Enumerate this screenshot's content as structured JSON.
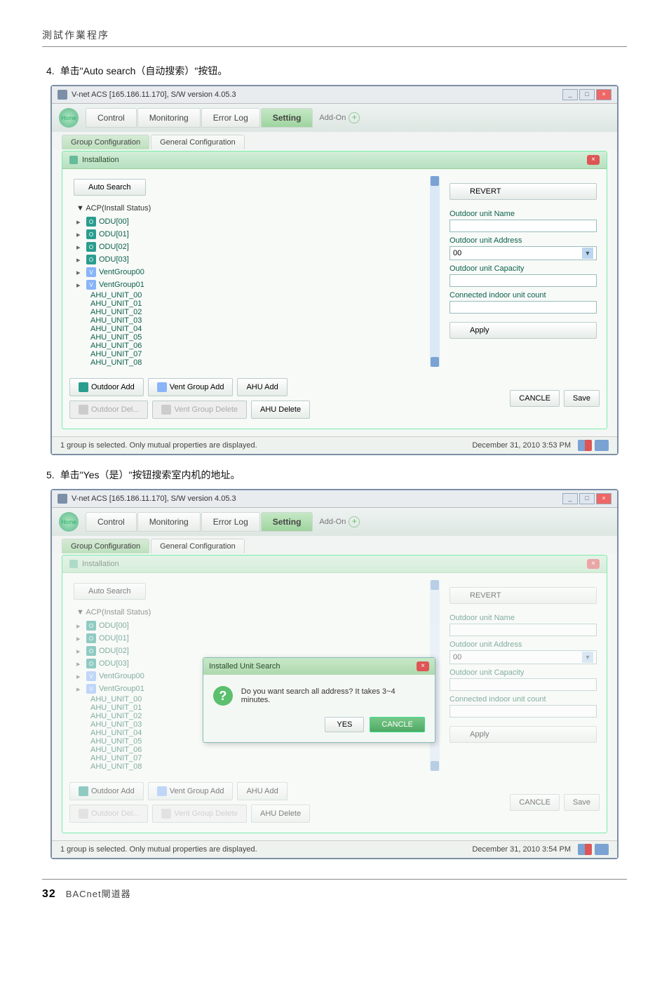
{
  "header": {
    "breadcrumb": "測試作業程序"
  },
  "steps": {
    "s4": {
      "num": "4.",
      "text": "单击\"Auto search（自动搜索）\"按钮。"
    },
    "s5": {
      "num": "5.",
      "text": "单击\"Yes（是）\"按钮搜索室内机的地址。"
    }
  },
  "window": {
    "title": "V-net ACS [165.186.11.170],   S/W version 4.05.3",
    "nav": {
      "home": "Home",
      "control": "Control",
      "monitoring": "Monitoring",
      "errorlog": "Error Log",
      "setting": "Setting",
      "addon": "Add-On"
    },
    "subtabs": {
      "group": "Group Configuration",
      "general": "General Configuration"
    },
    "innerTitle": "Installation",
    "autoSearch": "Auto Search",
    "revert": "REVERT",
    "tree": {
      "root": "▼ ACP(Install Status)",
      "odu": [
        "ODU[00]",
        "ODU[01]",
        "ODU[02]",
        "ODU[03]"
      ],
      "vent": [
        "VentGroup00",
        "VentGroup01"
      ],
      "ahu": [
        "AHU_UNIT_00",
        "AHU_UNIT_01",
        "AHU_UNIT_02",
        "AHU_UNIT_03",
        "AHU_UNIT_04",
        "AHU_UNIT_05",
        "AHU_UNIT_06",
        "AHU_UNIT_07",
        "AHU_UNIT_08"
      ]
    },
    "fields": {
      "name": "Outdoor unit Name",
      "address": "Outdoor unit Address",
      "addressVal": "00",
      "capacity": "Outdoor unit Capacity",
      "connected": "Connected indoor unit count",
      "apply": "Apply"
    },
    "actions": {
      "outdoorAdd": "Outdoor Add",
      "ventGroupAdd": "Vent Group Add",
      "ahuAdd": "AHU Add",
      "outdoorDel": "Outdoor Del...",
      "ventGroupDel": "Vent Group Delete",
      "ahuDelete": "AHU Delete",
      "cancle": "CANCLE",
      "save": "Save"
    },
    "status": {
      "left": "1 group is selected. Only mutual properties are displayed.",
      "right1": "December 31, 2010  3:53 PM",
      "right2": "December 31, 2010  3:54 PM"
    }
  },
  "dialog": {
    "title": "Installed Unit Search",
    "msg": "Do you want search all address? It takes 3~4 minutes.",
    "yes": "YES",
    "cancle": "CANCLE"
  },
  "footer": {
    "pageNum": "32",
    "label": "BACnet閘道器"
  }
}
